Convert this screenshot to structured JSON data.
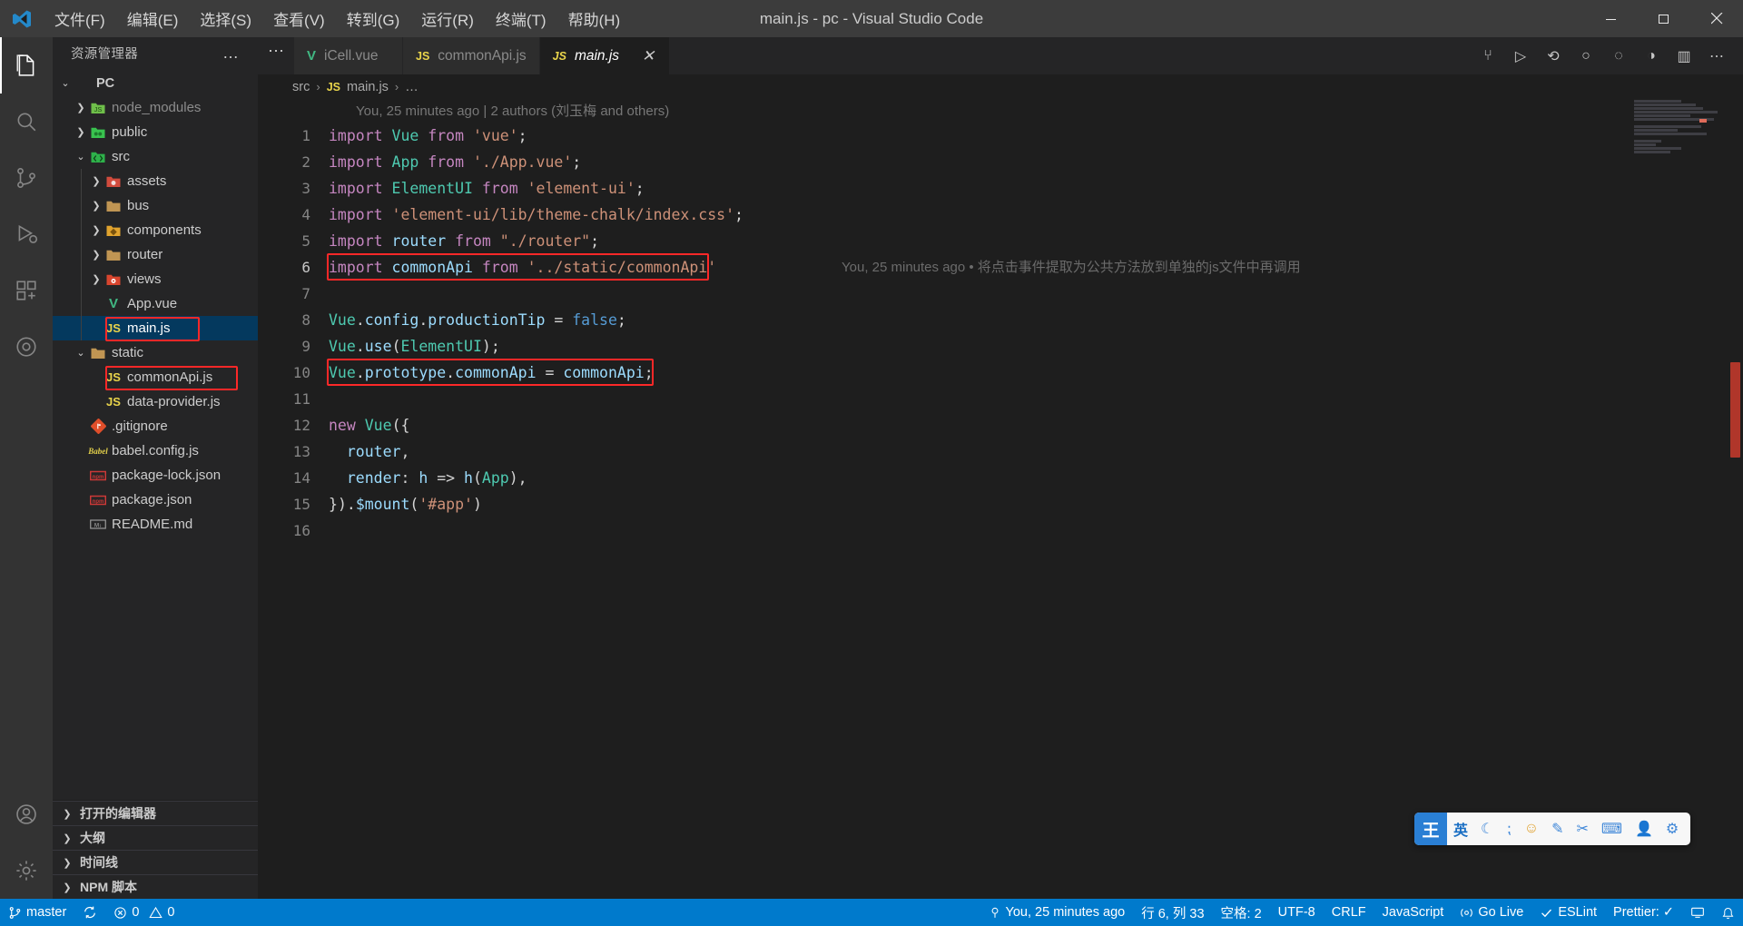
{
  "titlebar": {
    "logo_icon": "vscode-logo-icon",
    "menus": [
      "文件(F)",
      "编辑(E)",
      "选择(S)",
      "查看(V)",
      "转到(G)",
      "运行(R)",
      "终端(T)",
      "帮助(H)"
    ],
    "title": "main.js - pc - Visual Studio Code",
    "minimize_label": "—",
    "maximize_label": "❐",
    "close_label": "✕"
  },
  "activitybar": {
    "items": [
      {
        "name": "explorer",
        "icon": "files-icon",
        "active": true
      },
      {
        "name": "search",
        "icon": "search-icon",
        "active": false
      },
      {
        "name": "source-control",
        "icon": "source-control-icon",
        "active": false
      },
      {
        "name": "run-and-debug",
        "icon": "run-debug-icon",
        "active": false
      },
      {
        "name": "extensions",
        "icon": "extensions-icon",
        "active": false
      },
      {
        "name": "live-share",
        "icon": "live-share-icon",
        "active": false
      }
    ],
    "bottom": [
      {
        "name": "accounts",
        "icon": "account-icon"
      },
      {
        "name": "settings",
        "icon": "gear-icon"
      }
    ]
  },
  "sidebar": {
    "title": "资源管理器",
    "more_actions": "…",
    "tree": [
      {
        "label": "PC",
        "indent": 0,
        "chev": "down",
        "icon": "none",
        "bold": true,
        "selected": false
      },
      {
        "label": "node_modules",
        "indent": 1,
        "chev": "right",
        "icon": "folder-node",
        "bold": false,
        "selected": false,
        "dim": true
      },
      {
        "label": "public",
        "indent": 1,
        "chev": "right",
        "icon": "folder-public",
        "bold": false,
        "selected": false
      },
      {
        "label": "src",
        "indent": 1,
        "chev": "down",
        "icon": "folder-src",
        "bold": false,
        "selected": false
      },
      {
        "label": "assets",
        "indent": 2,
        "chev": "right",
        "icon": "folder-assets",
        "bold": false,
        "selected": false
      },
      {
        "label": "bus",
        "indent": 2,
        "chev": "right",
        "icon": "folder",
        "bold": false,
        "selected": false
      },
      {
        "label": "components",
        "indent": 2,
        "chev": "right",
        "icon": "folder-comp",
        "bold": false,
        "selected": false
      },
      {
        "label": "router",
        "indent": 2,
        "chev": "right",
        "icon": "folder",
        "bold": false,
        "selected": false
      },
      {
        "label": "views",
        "indent": 2,
        "chev": "right",
        "icon": "folder-views",
        "bold": false,
        "selected": false
      },
      {
        "label": "App.vue",
        "indent": 2,
        "chev": "none",
        "icon": "vue-file",
        "bold": false,
        "selected": false
      },
      {
        "label": "main.js",
        "indent": 2,
        "chev": "none",
        "icon": "js-file",
        "bold": false,
        "selected": true,
        "highlight": true
      },
      {
        "label": "static",
        "indent": 1,
        "chev": "down",
        "icon": "folder",
        "bold": false,
        "selected": false
      },
      {
        "label": "commonApi.js",
        "indent": 2,
        "chev": "none",
        "icon": "js-file",
        "bold": false,
        "selected": false,
        "highlight": true
      },
      {
        "label": "data-provider.js",
        "indent": 2,
        "chev": "none",
        "icon": "js-file",
        "bold": false,
        "selected": false
      },
      {
        "label": ".gitignore",
        "indent": 1,
        "chev": "none",
        "icon": "git-file",
        "bold": false,
        "selected": false
      },
      {
        "label": "babel.config.js",
        "indent": 1,
        "chev": "none",
        "icon": "babel-file",
        "bold": false,
        "selected": false
      },
      {
        "label": "package-lock.json",
        "indent": 1,
        "chev": "none",
        "icon": "npm-file",
        "bold": false,
        "selected": false
      },
      {
        "label": "package.json",
        "indent": 1,
        "chev": "none",
        "icon": "npm-file",
        "bold": false,
        "selected": false
      },
      {
        "label": "README.md",
        "indent": 1,
        "chev": "none",
        "icon": "md-file",
        "bold": false,
        "selected": false
      }
    ],
    "sections": [
      "打开的编辑器",
      "大纲",
      "时间线",
      "NPM 脚本"
    ]
  },
  "tabs": [
    {
      "label": "iCell.vue",
      "icon": "vue-file",
      "active": false,
      "closable": false
    },
    {
      "label": "commonApi.js",
      "icon": "js-file",
      "active": false,
      "closable": false
    },
    {
      "label": "main.js",
      "icon": "js-file",
      "active": true,
      "closable": true,
      "close_label": "✕"
    }
  ],
  "editor_actions": [
    {
      "name": "split-compare-icon",
      "glyph": "⑂"
    },
    {
      "name": "run-icon",
      "glyph": "▷"
    },
    {
      "name": "debug-step-icon",
      "glyph": "⟲"
    },
    {
      "name": "breakpoint-icon",
      "glyph": "○"
    },
    {
      "name": "watch-icon",
      "glyph": "◌"
    },
    {
      "name": "coverage-icon",
      "glyph": "◑"
    },
    {
      "name": "split-editor-icon",
      "glyph": "▥"
    },
    {
      "name": "more-actions-icon",
      "glyph": "⋯"
    }
  ],
  "breadcrumb": {
    "root": "src",
    "file": "main.js",
    "tail": "…",
    "separator": "›"
  },
  "editor": {
    "blame_top": "You, 25 minutes ago | 2 authors (刘玉梅 and others)",
    "blame_inline_line6": "You, 25 minutes ago • 将点击事件提取为公共方法放到单独的js文件中再调用",
    "lines": [
      {
        "no": "1",
        "code": "import Vue from 'vue';"
      },
      {
        "no": "2",
        "code": "import App from './App.vue';"
      },
      {
        "no": "3",
        "code": "import ElementUI from 'element-ui';"
      },
      {
        "no": "4",
        "code": "import 'element-ui/lib/theme-chalk/index.css';"
      },
      {
        "no": "5",
        "code": "import router from \"./router\";"
      },
      {
        "no": "6",
        "code": "import commonApi from '../static/commonApi'"
      },
      {
        "no": "7",
        "code": ""
      },
      {
        "no": "8",
        "code": "Vue.config.productionTip = false;"
      },
      {
        "no": "9",
        "code": "Vue.use(ElementUI);"
      },
      {
        "no": "10",
        "code": "Vue.prototype.commonApi = commonApi;"
      },
      {
        "no": "11",
        "code": ""
      },
      {
        "no": "12",
        "code": "new Vue({"
      },
      {
        "no": "13",
        "code": "  router,"
      },
      {
        "no": "14",
        "code": "  render: h => h(App),"
      },
      {
        "no": "15",
        "code": "}).$mount('#app')"
      },
      {
        "no": "16",
        "code": ""
      }
    ]
  },
  "ime": {
    "logo": "王",
    "items": [
      {
        "name": "lang-mode",
        "glyph": "英"
      },
      {
        "name": "moon-icon",
        "glyph": "☾"
      },
      {
        "name": "punctuation-icon",
        "glyph": "⁏"
      },
      {
        "name": "emoji-icon",
        "glyph": "☺"
      },
      {
        "name": "pen-icon",
        "glyph": "✎"
      },
      {
        "name": "scissors-icon",
        "glyph": "✂"
      },
      {
        "name": "keyboard-icon",
        "glyph": "⌨"
      },
      {
        "name": "user-icon",
        "glyph": "👤"
      },
      {
        "name": "settings-icon",
        "glyph": "⚙"
      }
    ]
  },
  "statusbar": {
    "left": [
      {
        "name": "remote-indicator",
        "glyph": "",
        "label": ""
      },
      {
        "name": "git-branch",
        "glyph": "⑂",
        "label": "master"
      },
      {
        "name": "sync-changes",
        "glyph": "⟳",
        "label": ""
      },
      {
        "name": "problems",
        "glyph": "",
        "label": "0",
        "glyph2": "",
        "label2": "0"
      }
    ],
    "blame": {
      "glyph": "⌀",
      "label": "You, 25 minutes ago"
    },
    "right": [
      {
        "name": "cursor-position",
        "label": "行 6, 列 33"
      },
      {
        "name": "indentation",
        "label": "空格: 2"
      },
      {
        "name": "encoding",
        "label": "UTF-8"
      },
      {
        "name": "eol",
        "label": "CRLF"
      },
      {
        "name": "language-mode",
        "label": "JavaScript"
      },
      {
        "name": "go-live",
        "label": "Go Live",
        "glyph": "◉"
      },
      {
        "name": "eslint",
        "label": "ESLint",
        "glyph": "✓"
      },
      {
        "name": "prettier",
        "label": "Prettier: ✓"
      },
      {
        "name": "remote-open",
        "glyph": "⌸"
      },
      {
        "name": "notifications",
        "glyph": "🔔"
      }
    ]
  },
  "colors": {
    "accent": "#007acc",
    "annotation_red": "#fc2828",
    "selection_blue": "#04395e",
    "editor_bg": "#1e1e1e",
    "sidebar_bg": "#252526"
  }
}
